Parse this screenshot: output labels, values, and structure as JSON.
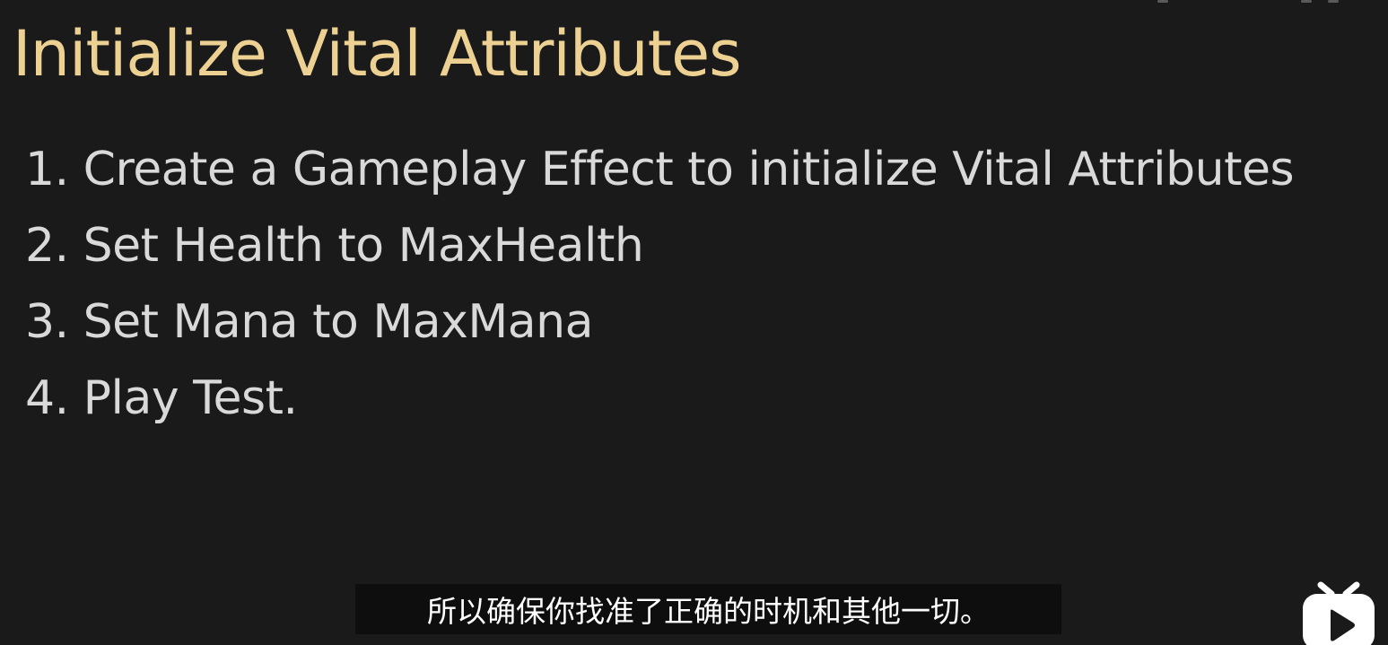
{
  "slide": {
    "title": "Initialize Vital Attributes",
    "bullets": [
      "1. Create a Gameplay Effect to initialize Vital Attributes",
      "2. Set Health to MaxHealth",
      "3. Set Mana to MaxMana",
      "4. Play Test."
    ]
  },
  "subtitle": {
    "text": "所以确保你找准了正确的时机和其他一切。"
  },
  "colors": {
    "background": "#1a1a1a",
    "title": "#ecd192",
    "body_text": "#d9d9d9",
    "subtitle_bg": "#0e0e0e",
    "subtitle_text": "#ffffff",
    "logo": "#ffffff"
  },
  "icons": {
    "corner_logo": "bilibili-tv-icon"
  }
}
